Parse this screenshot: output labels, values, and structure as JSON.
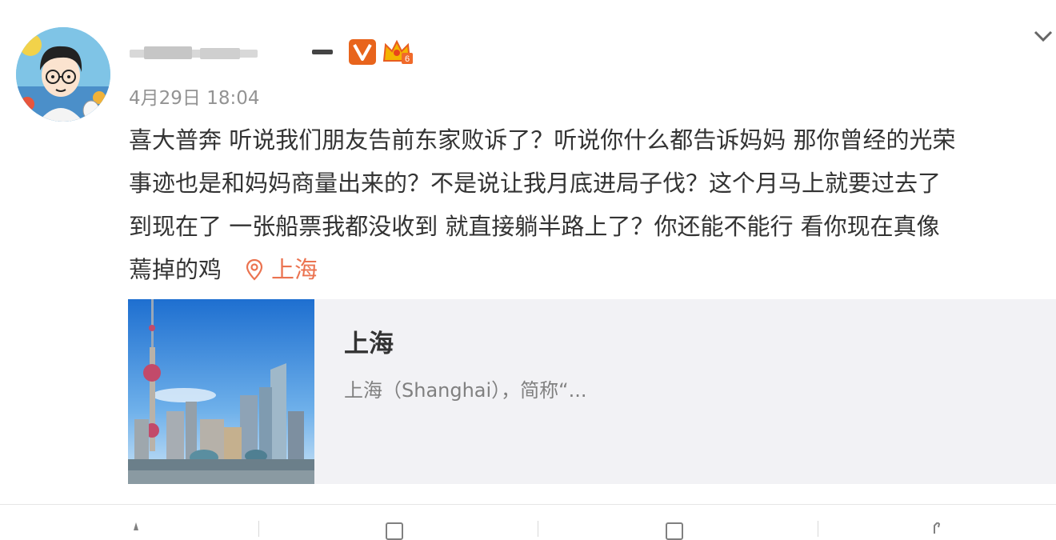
{
  "post": {
    "time": "4月29日 18:04",
    "lines": [
      "喜大普奔 听说我们朋友告前东家败诉了？听说你什么都告诉妈妈 那你曾经的光荣",
      "事迹也是和妈妈商量出来的？不是说让我月底进局子伐？这个月马上就要过去了",
      "到现在了 一张船票我都没收到 就直接躺半路上了？你还能不能行 看你现在真像",
      "蔫掉的鸡"
    ],
    "location": "上海"
  },
  "card": {
    "title": "上海",
    "description": "上海（Shanghai），简称“..."
  },
  "icons": {
    "avatar": "avatar-illustration",
    "verified": "verified-v-icon",
    "crown": "member-crown-icon",
    "dropdown": "chevron-down-icon",
    "location": "location-pin-icon"
  },
  "colors": {
    "accent_orange": "#eb7350",
    "verified_badge": "#e8641c",
    "text_primary": "#333333",
    "text_muted": "#939393",
    "card_bg": "#f2f2f5"
  }
}
